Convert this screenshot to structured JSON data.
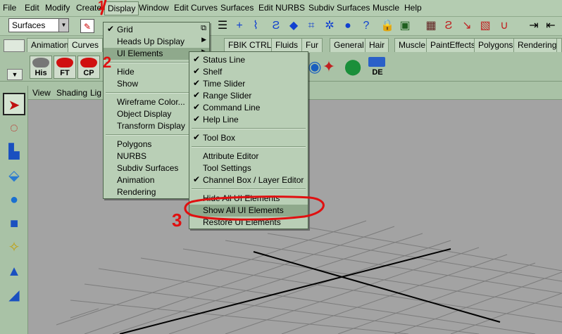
{
  "menubar": {
    "items": [
      "File",
      "Edit",
      "Modify",
      "Create",
      "Display",
      "Window",
      "Edit Curves",
      "Surfaces",
      "Edit NURBS",
      "Subdiv Surfaces",
      "Muscle",
      "Help"
    ]
  },
  "statusline": {
    "mode": "Surfaces"
  },
  "shelf_tabs": [
    "Animation",
    "Curves",
    "FBIK CTRL",
    "Fluids",
    "Fur",
    "General",
    "Hair",
    "Muscle",
    "PaintEffects",
    "Polygons",
    "Rendering"
  ],
  "shelf_buttons": [
    "His",
    "FT",
    "CP",
    "DE"
  ],
  "panel_menu": [
    "View",
    "Shading",
    "Lighting"
  ],
  "display_menu": {
    "items": [
      {
        "label": "Grid",
        "checked": true,
        "option_box": true
      },
      {
        "label": "Heads Up Display",
        "submenu": true
      },
      {
        "label": "UI Elements",
        "submenu": true,
        "highlighted": true
      },
      {
        "label": "Hide",
        "submenu": true
      },
      {
        "label": "Show",
        "submenu": true
      },
      {
        "label": "Wireframe Color..."
      },
      {
        "label": "Object Display",
        "submenu": true
      },
      {
        "label": "Transform Display",
        "submenu": true
      },
      {
        "label": "Polygons",
        "submenu": true
      },
      {
        "label": "NURBS",
        "submenu": true
      },
      {
        "label": "Subdiv Surfaces",
        "submenu": true
      },
      {
        "label": "Animation",
        "submenu": true
      },
      {
        "label": "Rendering",
        "submenu": true
      }
    ]
  },
  "ui_elements_menu": {
    "items": [
      {
        "label": "Status Line",
        "checked": true
      },
      {
        "label": "Shelf",
        "checked": true
      },
      {
        "label": "Time Slider",
        "checked": true
      },
      {
        "label": "Range Slider",
        "checked": true
      },
      {
        "label": "Command Line",
        "checked": true
      },
      {
        "label": "Help Line",
        "checked": true
      },
      {
        "label": "Tool Box",
        "checked": true
      },
      {
        "label": "Attribute Editor"
      },
      {
        "label": "Tool Settings"
      },
      {
        "label": "Channel Box / Layer Editor",
        "checked": true
      },
      {
        "label": "Hide All UI Elements"
      },
      {
        "label": "Show All UI Elements",
        "highlighted": true
      },
      {
        "label": "Restore UI Elements"
      }
    ]
  },
  "annotations": {
    "step1": "1",
    "step2": "2",
    "step3": "3",
    "color": "#e01010"
  }
}
